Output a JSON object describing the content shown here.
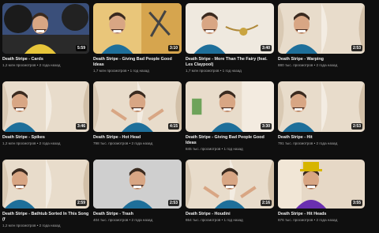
{
  "videos": [
    {
      "title": "Death Stripe - Cards",
      "duration": "5:59",
      "views": "1,2 млн просмотров",
      "age": "2 года назад",
      "scene": "tyres"
    },
    {
      "title": "Death Stripe - Giving Bad People Good Ideas",
      "duration": "3:10",
      "views": "1,7 млн просмотров",
      "age": "1 год назад",
      "scene": "scissors"
    },
    {
      "title": "Death Stripe - More Than The Fairy (feat. Les Claypool)",
      "duration": "3:40",
      "views": "1,7 млн просмотров",
      "age": "1 год назад",
      "scene": "coin"
    },
    {
      "title": "Death Stripe - Warping",
      "duration": "2:53",
      "views": "880 тыс. просмотров",
      "age": "2 года назад",
      "scene": "curtain"
    },
    {
      "title": "Death Stripe - Spikes",
      "duration": "3:46",
      "views": "1,2 млн просмотров",
      "age": "2 года назад",
      "scene": "curtain-left"
    },
    {
      "title": "Death Stripe - Hot Head",
      "duration": "4:15",
      "views": "798 тыс. просмотров",
      "age": "2 года назад",
      "scene": "shrug"
    },
    {
      "title": "Death Stripe - Giving Bad People Good Ideas",
      "duration": "3:30",
      "views": "845 тыс. просмотров",
      "age": "1 год назад",
      "scene": "money"
    },
    {
      "title": "Death Stripe - Hit",
      "duration": "2:53",
      "views": "791 тыс. просмотров",
      "age": "2 года назад",
      "scene": "curtain-point"
    },
    {
      "title": "Death Stripe - Bathtub Sorted In This Song (f",
      "duration": "2:59",
      "views": "1,2 млн просмотров",
      "age": "2 года назад",
      "scene": "curtain-left"
    },
    {
      "title": "Death Stripe - Trash",
      "duration": "2:53",
      "views": "404 тыс. просмотров",
      "age": "2 года назад",
      "scene": "front"
    },
    {
      "title": "Death Stripe - Houdini",
      "duration": "2:16",
      "views": "654 тыс. просмотров",
      "age": "1 год назад",
      "scene": "shrug"
    },
    {
      "title": "Death Stripe - Hit Heads",
      "duration": "3:55",
      "views": "676 тыс. просмотров",
      "age": "2 года назад",
      "scene": "wonka"
    }
  ],
  "colors": {
    "background": "#0f0f0f",
    "title": "#f1f1f1",
    "meta": "#aaaaaa",
    "shirt_blue": "#1e6f9a",
    "curtain": "#e8dccb",
    "skin": "#d8a684"
  }
}
